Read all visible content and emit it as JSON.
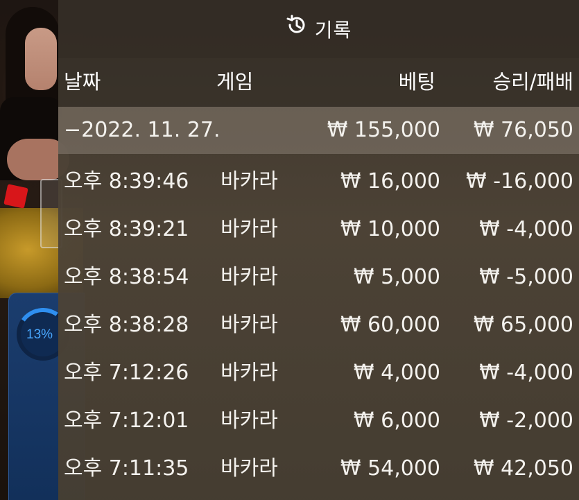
{
  "background": {
    "progress_percent": "13%",
    "progress_fraction": 0.13
  },
  "history": {
    "title": "기록",
    "title_icon": "history-clock-icon",
    "columns": {
      "date": "날짜",
      "game": "게임",
      "bet": "베팅",
      "result": "승리/패배"
    },
    "summary": {
      "date": "−2022. 11. 27.",
      "bet": "₩ 155,000",
      "result": "₩ 76,050"
    },
    "rows": [
      {
        "time": "오후 8:39:46",
        "game": "바카라",
        "bet": "₩ 16,000",
        "result": "₩ -16,000"
      },
      {
        "time": "오후 8:39:21",
        "game": "바카라",
        "bet": "₩ 10,000",
        "result": "₩ -4,000"
      },
      {
        "time": "오후 8:38:54",
        "game": "바카라",
        "bet": "₩ 5,000",
        "result": "₩ -5,000"
      },
      {
        "time": "오후 8:38:28",
        "game": "바카라",
        "bet": "₩ 60,000",
        "result": "₩ 65,000"
      },
      {
        "time": "오후 7:12:26",
        "game": "바카라",
        "bet": "₩ 4,000",
        "result": "₩ -4,000"
      },
      {
        "time": "오후 7:12:01",
        "game": "바카라",
        "bet": "₩ 6,000",
        "result": "₩ -2,000"
      },
      {
        "time": "오후 7:11:35",
        "game": "바카라",
        "bet": "₩ 54,000",
        "result": "₩ 42,050"
      }
    ]
  }
}
